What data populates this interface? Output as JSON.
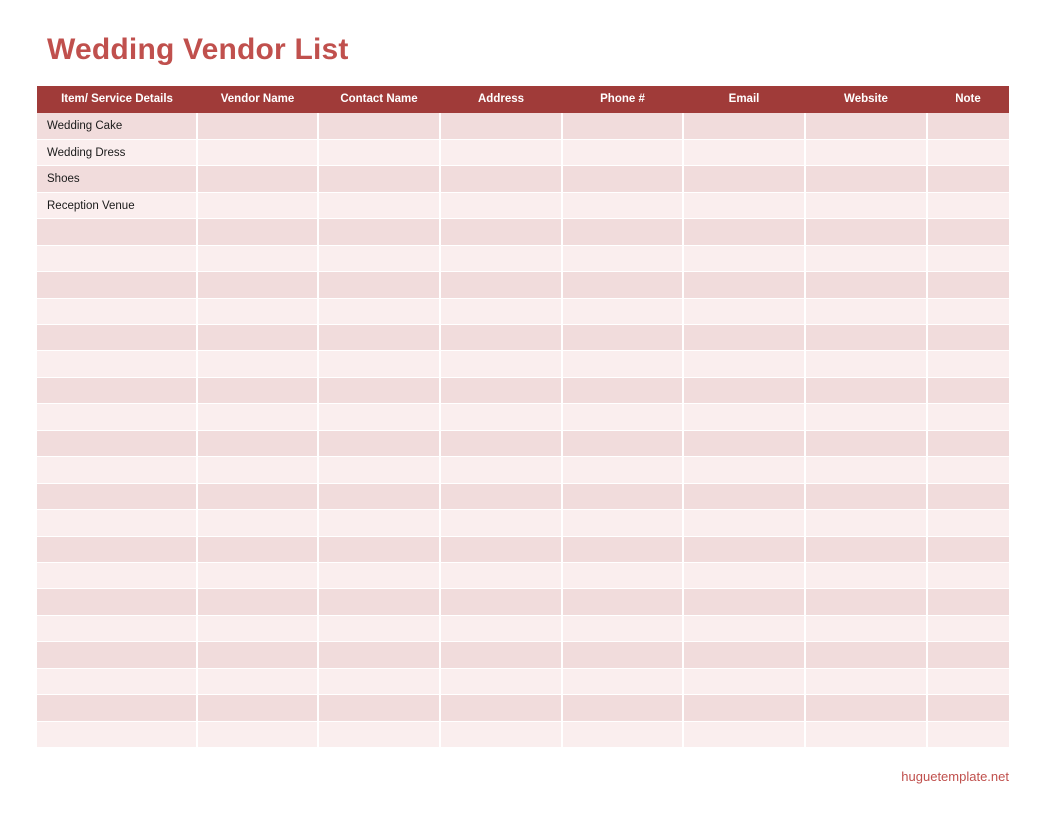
{
  "document": {
    "title": "Wedding Vendor List",
    "accent_color": "#c0504d",
    "header_bg_color": "#a03b39",
    "row_band_dark": "#f1dcdc",
    "row_band_light": "#faeeee"
  },
  "table": {
    "columns": [
      "Item/ Service Details",
      "Vendor Name",
      "Contact Name",
      "Address",
      "Phone #",
      "Email",
      "Website",
      "Note"
    ],
    "rows": [
      [
        "Wedding Cake",
        "",
        "",
        "",
        "",
        "",
        "",
        ""
      ],
      [
        "Wedding Dress",
        "",
        "",
        "",
        "",
        "",
        "",
        ""
      ],
      [
        "Shoes",
        "",
        "",
        "",
        "",
        "",
        "",
        ""
      ],
      [
        "Reception Venue",
        "",
        "",
        "",
        "",
        "",
        "",
        ""
      ],
      [
        "",
        "",
        "",
        "",
        "",
        "",
        "",
        ""
      ],
      [
        "",
        "",
        "",
        "",
        "",
        "",
        "",
        ""
      ],
      [
        "",
        "",
        "",
        "",
        "",
        "",
        "",
        ""
      ],
      [
        "",
        "",
        "",
        "",
        "",
        "",
        "",
        ""
      ],
      [
        "",
        "",
        "",
        "",
        "",
        "",
        "",
        ""
      ],
      [
        "",
        "",
        "",
        "",
        "",
        "",
        "",
        ""
      ],
      [
        "",
        "",
        "",
        "",
        "",
        "",
        "",
        ""
      ],
      [
        "",
        "",
        "",
        "",
        "",
        "",
        "",
        ""
      ],
      [
        "",
        "",
        "",
        "",
        "",
        "",
        "",
        ""
      ],
      [
        "",
        "",
        "",
        "",
        "",
        "",
        "",
        ""
      ],
      [
        "",
        "",
        "",
        "",
        "",
        "",
        "",
        ""
      ],
      [
        "",
        "",
        "",
        "",
        "",
        "",
        "",
        ""
      ],
      [
        "",
        "",
        "",
        "",
        "",
        "",
        "",
        ""
      ],
      [
        "",
        "",
        "",
        "",
        "",
        "",
        "",
        ""
      ],
      [
        "",
        "",
        "",
        "",
        "",
        "",
        "",
        ""
      ],
      [
        "",
        "",
        "",
        "",
        "",
        "",
        "",
        ""
      ],
      [
        "",
        "",
        "",
        "",
        "",
        "",
        "",
        ""
      ],
      [
        "",
        "",
        "",
        "",
        "",
        "",
        "",
        ""
      ],
      [
        "",
        "",
        "",
        "",
        "",
        "",
        "",
        ""
      ],
      [
        "",
        "",
        "",
        "",
        "",
        "",
        "",
        ""
      ]
    ]
  },
  "footer": {
    "link_label": "huguetemplate.net"
  }
}
